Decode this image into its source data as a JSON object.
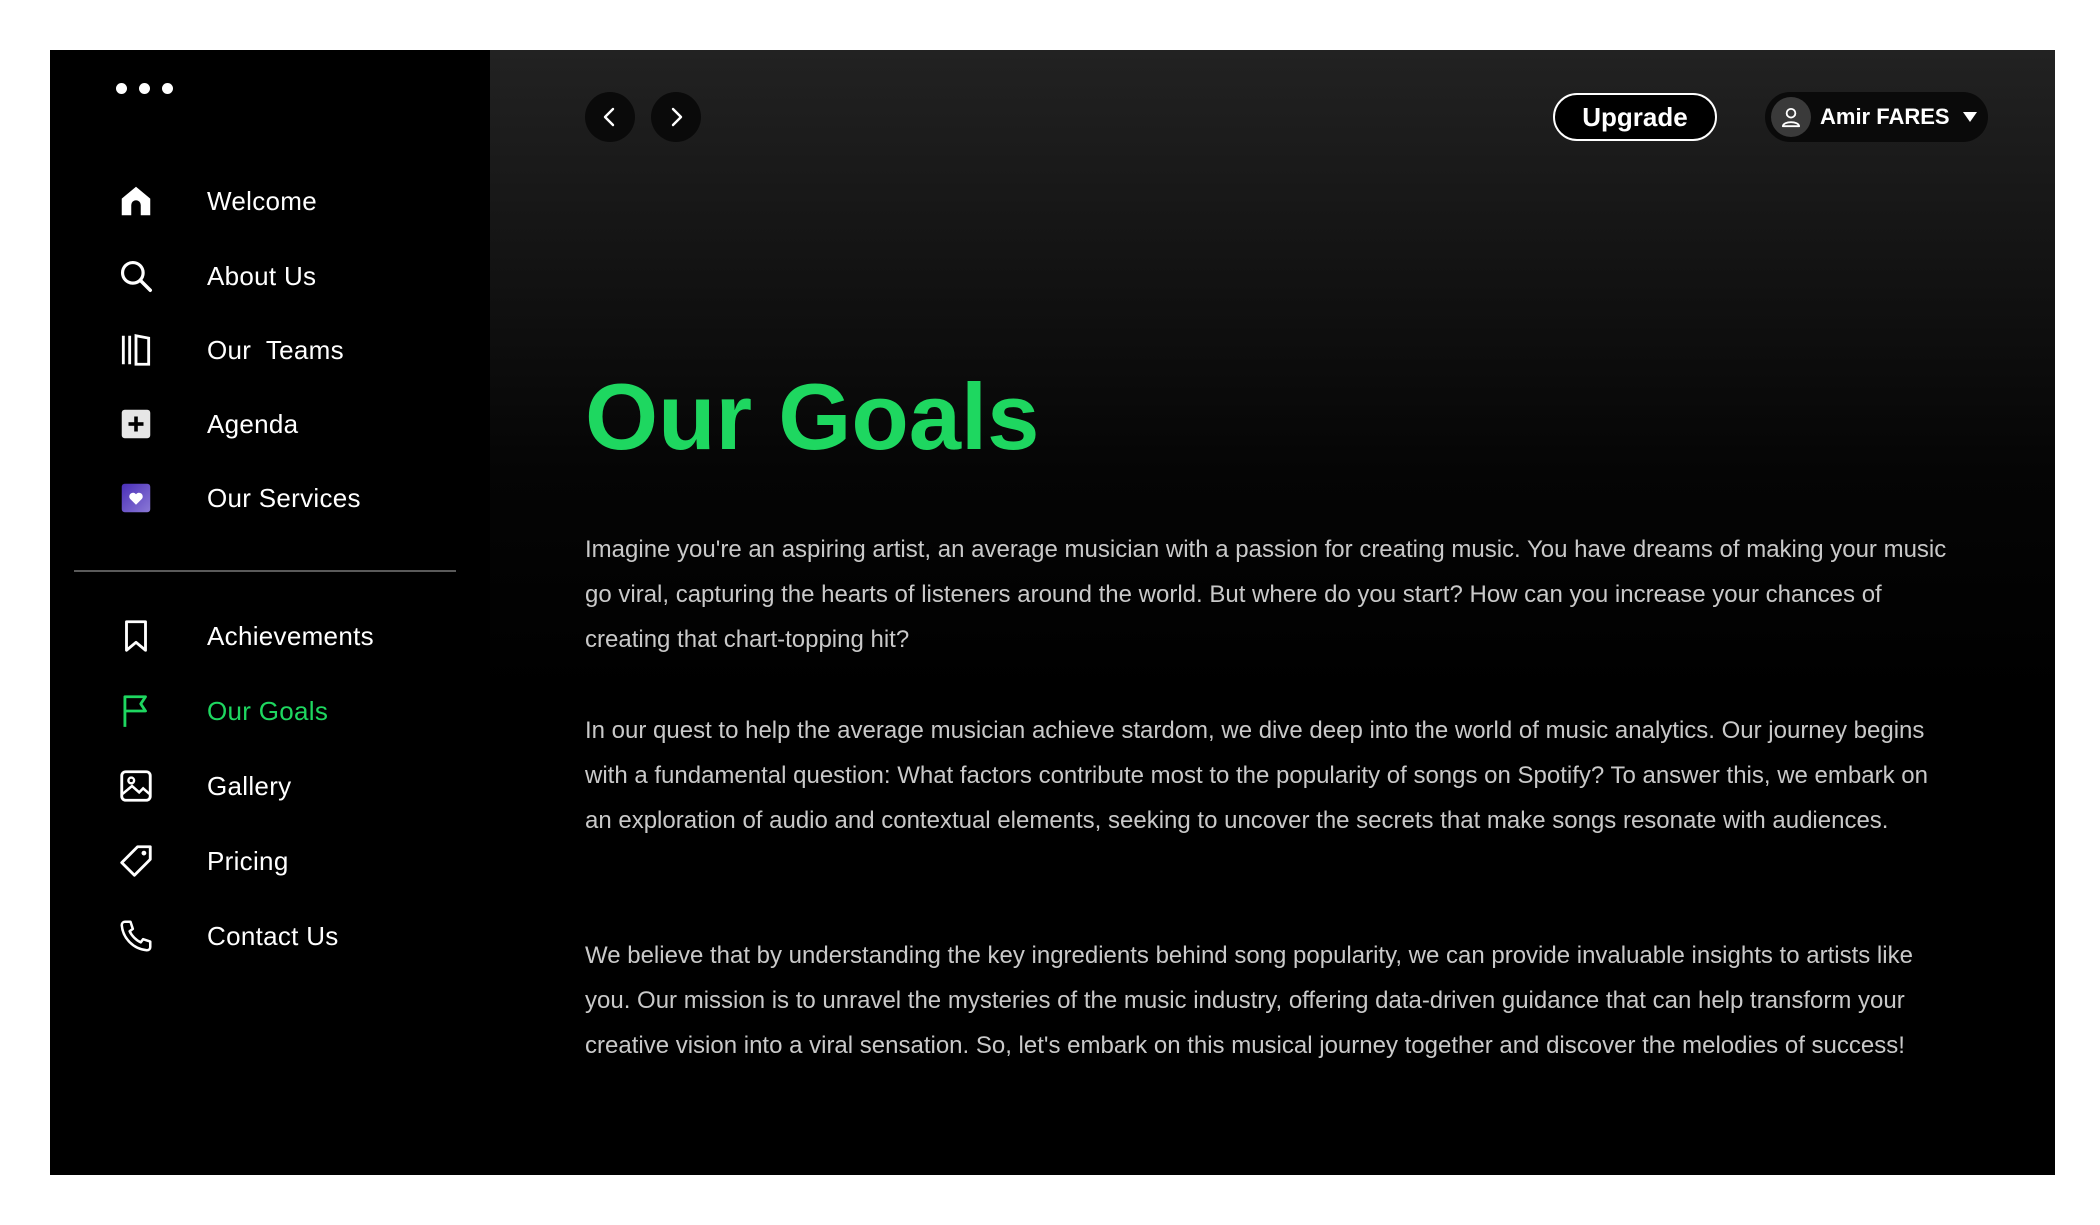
{
  "sidebar": {
    "primary_items": [
      {
        "label": "Welcome",
        "icon": "home-icon"
      },
      {
        "label": "About Us",
        "icon": "search-icon"
      },
      {
        "label": "Our  Teams",
        "icon": "library-icon"
      },
      {
        "label": "Agenda",
        "icon": "plus-square-icon"
      },
      {
        "label": "Our Services",
        "icon": "heart-square-icon"
      }
    ],
    "secondary_items": [
      {
        "label": "Achievements",
        "icon": "bookmark-icon"
      },
      {
        "label": "Our Goals",
        "icon": "flag-icon",
        "active": true
      },
      {
        "label": "Gallery",
        "icon": "image-icon"
      },
      {
        "label": "Pricing",
        "icon": "tag-icon"
      },
      {
        "label": "Contact Us",
        "icon": "phone-icon"
      }
    ]
  },
  "header": {
    "back_icon": "chevron-left-icon",
    "forward_icon": "chevron-right-icon",
    "upgrade_label": "Upgrade",
    "user_name": "Amir FARES",
    "user_icon": "user-icon",
    "caret_icon": "caret-down-icon"
  },
  "main": {
    "title": "Our Goals",
    "paragraphs": [
      "Imagine you're an aspiring artist, an average musician with a passion for creating music. You have dreams of making your music go viral, capturing the hearts of listeners around the world. But where do you start? How can you increase your chances of creating that chart-topping hit?",
      "In our quest to help the average musician achieve stardom, we dive deep into the world of music analytics. Our journey begins with a fundamental question: What factors contribute most to the popularity of songs on Spotify? To answer this, we embark on an exploration of audio and contextual elements, seeking to uncover the secrets that make songs resonate with audiences.",
      "We believe that by understanding the key ingredients behind song popularity, we can provide invaluable insights to artists like you. Our mission is to unravel the mysteries of the music industry, offering data-driven guidance that can help transform your creative vision into a viral sensation. So, let's embark on this musical journey together and discover the melodies of success!"
    ]
  },
  "colors": {
    "accent": "#1ed760",
    "background": "#000000",
    "text": "#ffffff",
    "body_text": "#c9c9c9",
    "services_icon": "#6b4fc8"
  }
}
